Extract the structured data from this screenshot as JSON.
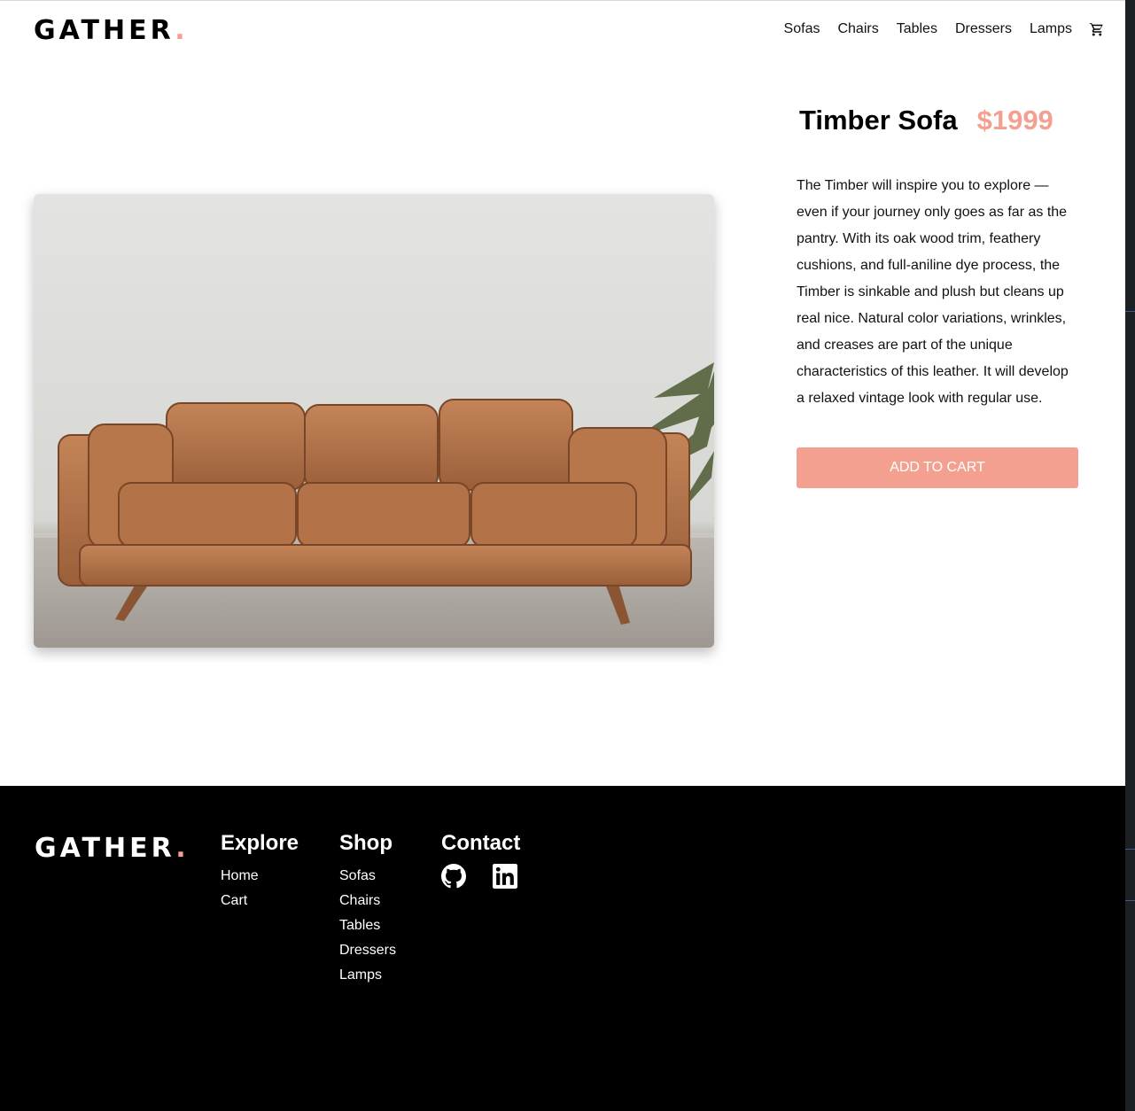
{
  "brand": {
    "name": "GATHER",
    "dot": ".",
    "accent_color": "#f4a090"
  },
  "nav": {
    "items": [
      "Sofas",
      "Chairs",
      "Tables",
      "Dressers",
      "Lamps"
    ],
    "cart_icon": "shopping-cart-icon"
  },
  "product": {
    "name": "Timber Sofa",
    "price": "$1999",
    "description": "The Timber will inspire you to explore — even if your journey only goes as far as the pantry. With its oak wood trim, feathery cushions, and full-aniline dye process, the Timber is sinkable and plush but cleans up real nice. Natural color variations, wrinkles, and creases are part of the unique characteristics of this leather. It will develop a relaxed vintage look with regular use.",
    "add_to_cart_label": "ADD TO CART"
  },
  "footer": {
    "explore": {
      "heading": "Explore",
      "links": [
        "Home",
        "Cart"
      ]
    },
    "shop": {
      "heading": "Shop",
      "links": [
        "Sofas",
        "Chairs",
        "Tables",
        "Dressers",
        "Lamps"
      ]
    },
    "contact": {
      "heading": "Contact",
      "icons": [
        "github-icon",
        "linkedin-icon"
      ]
    }
  }
}
